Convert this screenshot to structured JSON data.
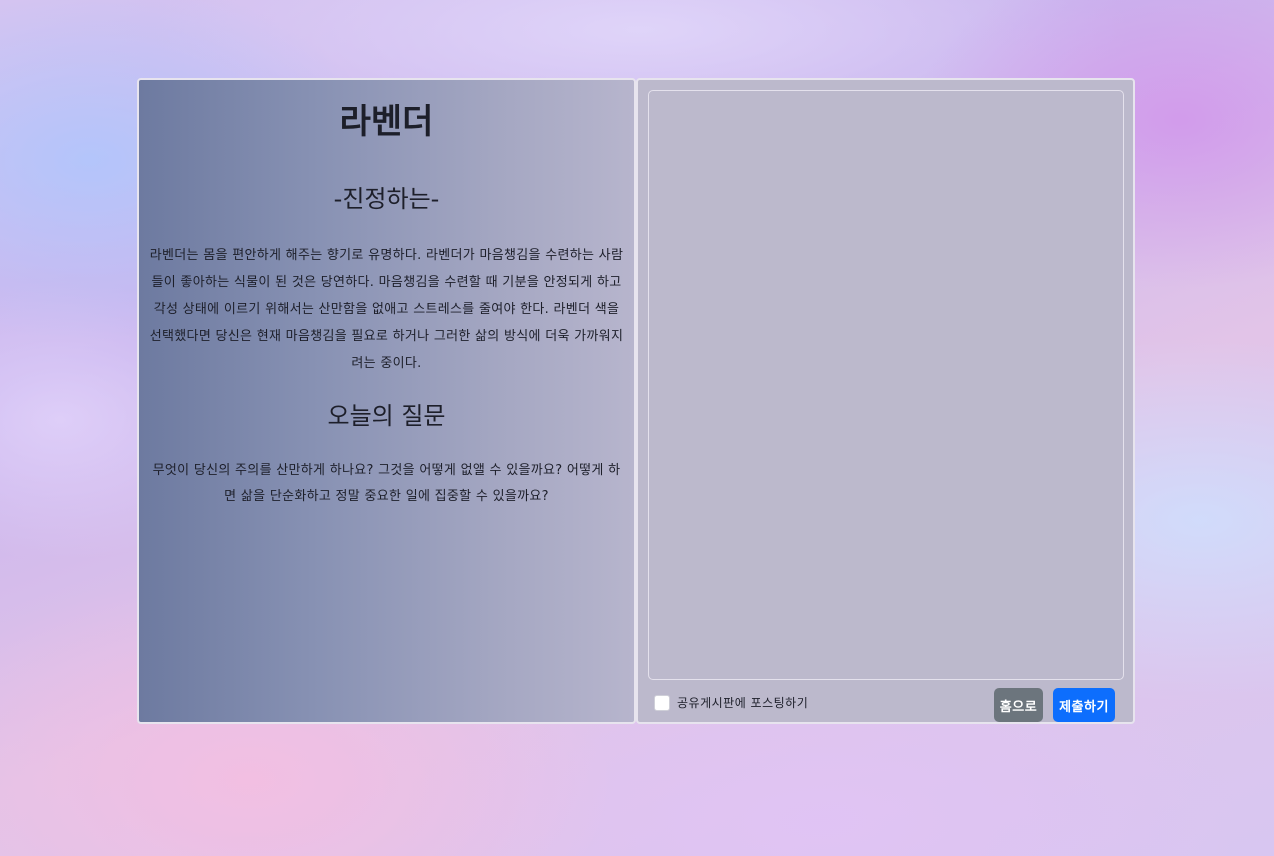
{
  "card": {
    "title": "라벤더",
    "subtitle": "-진정하는-",
    "description": "라벤더는 몸을 편안하게 해주는 향기로 유명하다. 라벤더가 마음챙김을 수련하는 사람들이 좋아하는 식물이 된 것은 당연하다. 마음챙김을 수련할 때 기분을 안정되게 하고 각성 상태에 이르기 위해서는 산만함을 없애고 스트레스를 줄여야 한다. 라벤더 색을 선택했다면 당신은 현재 마음챙김을 필요로 하거나 그러한 삶의 방식에 더욱 가까워지려는 중이다.",
    "question_heading": "오늘의 질문",
    "question_text": "무엇이 당신의 주의를 산만하게 하나요? 그것을 어떻게 없앨 수 있을까요? 어떻게 하면 삶을 단순화하고 정말 중요한 일에 집중할 수 있을까요?"
  },
  "form": {
    "answer_value": "",
    "share_checked": false,
    "share_label": "공유게시판에 포스팅하기",
    "home_label": "홈으로",
    "submit_label": "제출하기"
  },
  "colors": {
    "home_button": "#6c757d",
    "submit_button": "#0d6efd",
    "left_panel_start": "#6d7aa0",
    "left_panel_end": "#b7b5cd",
    "right_panel": "#bcb9cc"
  }
}
